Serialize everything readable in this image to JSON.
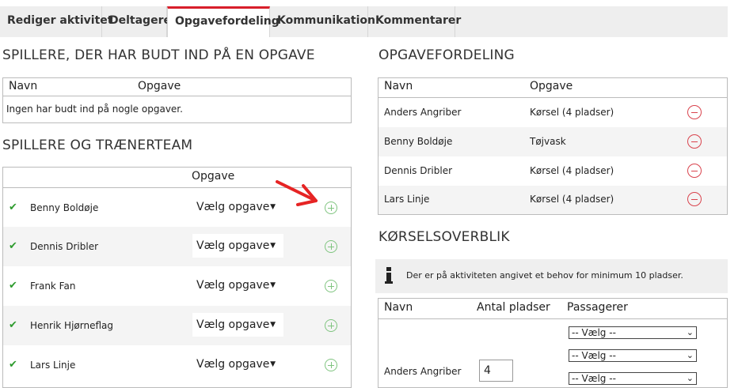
{
  "tabs": [
    {
      "label": "Rediger aktivitet"
    },
    {
      "label": "Deltagere"
    },
    {
      "label": "Opgavefordeling"
    },
    {
      "label": "Kommunikation"
    },
    {
      "label": "Kommentarer"
    }
  ],
  "left": {
    "bids_heading": "SPILLERE, DER HAR BUDT IND PÅ EN OPGAVE",
    "bids_table": {
      "col_name": "Navn",
      "col_task": "Opgave",
      "empty_text": "Ingen har budt ind på nogle opgaver."
    },
    "team_heading": "SPILLERE OG TRÆNERTEAM",
    "team_table": {
      "col_task": "Opgave",
      "select_placeholder": "Vælg opgave",
      "rows": [
        {
          "name": "Benny Boldøje"
        },
        {
          "name": "Dennis Dribler"
        },
        {
          "name": "Frank Fan"
        },
        {
          "name": "Henrik Hjørneflag"
        },
        {
          "name": "Lars Linje"
        }
      ]
    }
  },
  "right": {
    "assign_heading": "OPGAVEFORDELING",
    "assign_table": {
      "col_name": "Navn",
      "col_task": "Opgave",
      "rows": [
        {
          "name": "Anders Angriber",
          "task": "Kørsel (4 pladser)"
        },
        {
          "name": "Benny Boldøje",
          "task": "Tøjvask"
        },
        {
          "name": "Dennis Dribler",
          "task": "Kørsel (4 pladser)"
        },
        {
          "name": "Lars Linje",
          "task": "Kørsel (4 pladser)"
        }
      ]
    },
    "driving_heading": "KØRSELSOVERBLIK",
    "info_text": "Der er på aktiviteten angivet et behov for minimum 10 pladser.",
    "driving_table": {
      "col_name": "Navn",
      "col_seats": "Antal pladser",
      "col_passengers": "Passagerer",
      "rows": [
        {
          "name": "Anders Angriber",
          "seats": "4",
          "passenger_options": [
            "-- Vælg --",
            "-- Vælg --",
            "-- Vælg --"
          ]
        }
      ]
    }
  },
  "colors": {
    "accent": "#d81e2a",
    "check": "#2e9b2e",
    "add": "#7fc47f",
    "remove": "#d9434d"
  },
  "icons": {
    "check": "✔",
    "caret": "▼"
  }
}
